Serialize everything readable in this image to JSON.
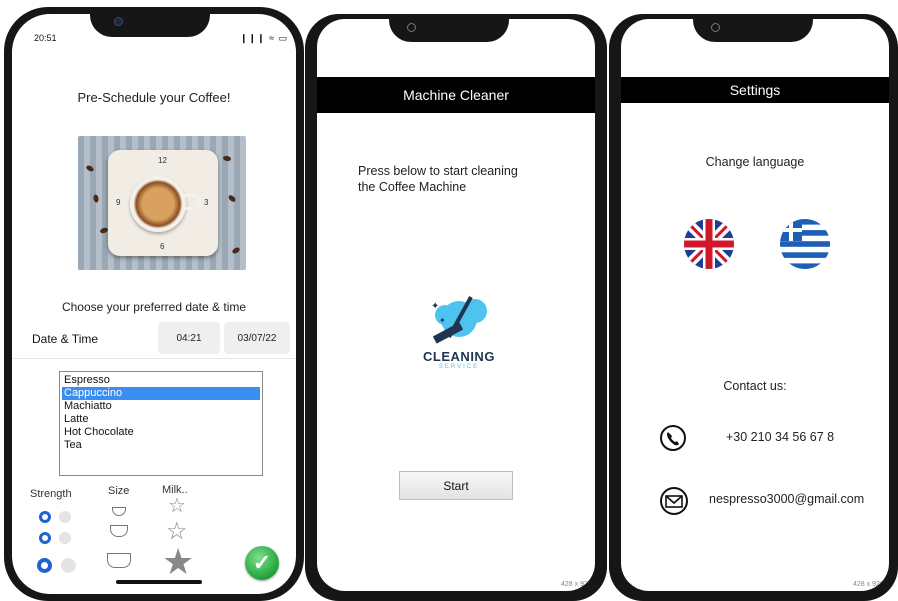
{
  "phone1": {
    "status_time": "20:51",
    "status_icons": "❙❙❙ ≈ ▭",
    "title": "Pre-Schedule your Coffee!",
    "clock_numbers": [
      "12",
      "3",
      "6",
      "9"
    ],
    "subtitle": "Choose your preferred date & time",
    "datetime_label": "Date & Time",
    "time_value": "04:21",
    "date_value": "03/07/22",
    "drinks": [
      "Espresso",
      "Cappuccino",
      "Machiatto",
      "Latte",
      "Hot Chocolate",
      "Tea"
    ],
    "selected_drink": "Cappuccino",
    "labels": {
      "strength": "Strength",
      "size": "Size",
      "milk": "Milk.."
    },
    "confirm_icon": "check-icon"
  },
  "phone2": {
    "header": "Machine Cleaner",
    "instruction_line1": "Press below to start cleaning",
    "instruction_line2": "the Coffee Machine",
    "logo_text": "CLEANING",
    "logo_sub": "SERVICE",
    "start_label": "Start",
    "dim_label": "428 x 926"
  },
  "phone3": {
    "header": "Settings",
    "change_language": "Change language",
    "contact": "Contact us:",
    "phone": "+30 210 34 56 67 8",
    "email": "nespresso3000@gmail.com",
    "dim_label": "428 x 926"
  },
  "colors": {
    "accent": "#1f63d3",
    "selection": "#3a8ef0",
    "header": "#000000",
    "check": "#1fa23a"
  }
}
